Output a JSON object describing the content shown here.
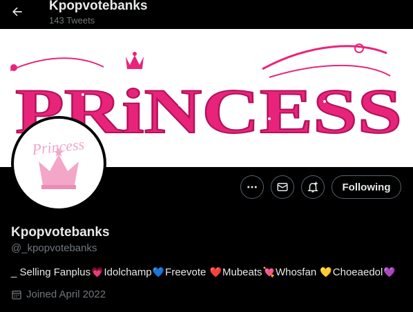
{
  "header": {
    "title": "Kpopvotebanks",
    "tweet_count": "143 Tweets"
  },
  "banner": {
    "text": "PRiNCESS"
  },
  "avatar": {
    "text": "Princess"
  },
  "actions": {
    "follow_label": "Following"
  },
  "profile": {
    "name": "Kpopvotebanks",
    "handle": "@_kpopvotebanks",
    "bio": [
      {
        "text": "_ Selling Fanplus",
        "heart": "💗",
        "color": "#f0609a"
      },
      {
        "text": "Idolchamp",
        "heart": "💙",
        "color": "#5da9e9"
      },
      {
        "text": "Freevote ",
        "heart": "❤️",
        "color": "#e0245e"
      },
      {
        "text": "Mubeats",
        "heart": "💘",
        "color": "#e0245e"
      },
      {
        "text": "Whosfan ",
        "heart": "💛",
        "color": "#f9c74f"
      },
      {
        "text": "Choeaedol",
        "heart": "💜",
        "color": "#a77bdc"
      }
    ],
    "joined": "Joined April 2022"
  },
  "colors": {
    "accent_pink": "#e8247a",
    "light_pink": "#f3a6c8",
    "border": "#536471",
    "muted": "#71767b"
  }
}
